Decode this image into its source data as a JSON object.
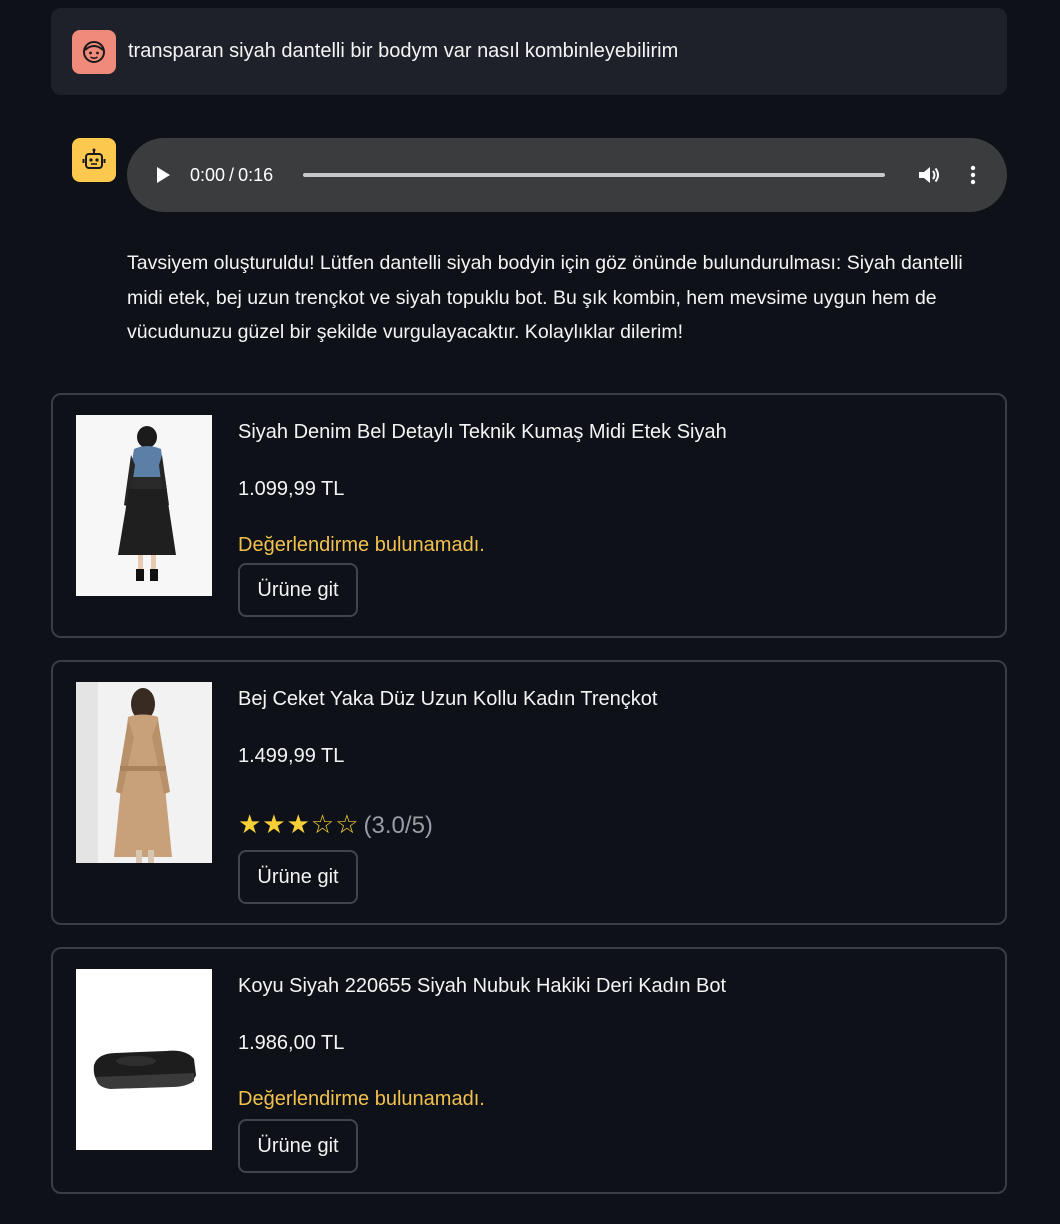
{
  "user_message": {
    "text": "transparan siyah dantelli bir bodym var nasıl kombinleyebilirim",
    "avatar_icon": "user-face-icon",
    "avatar_color": "#f08a7b"
  },
  "bot_message": {
    "avatar_icon": "robot-icon",
    "avatar_color": "#fcc94e",
    "audio": {
      "current_time": "0:00",
      "duration": "0:16",
      "separator": "/",
      "progress": 0,
      "play_icon": "play-icon",
      "volume_icon": "volume-icon",
      "menu_icon": "more-vertical-icon"
    },
    "text": "Tavsiyem oluşturuldu! Lütfen dantelli siyah bodyin için göz önünde bulundurulması: Siyah dantelli midi etek, bej uzun trençkot ve siyah topuklu bot. Bu şık kombin, hem mevsime uygun hem de vücudunuzu güzel bir şekilde vurgulayacaktır. Kolaylıklar dilerim!"
  },
  "products": [
    {
      "title": "Siyah Denim Bel Detaylı Teknik Kumaş Midi Etek Siyah",
      "price": "1.099,99 TL",
      "rating_text": "Değerlendirme bulunamadı.",
      "button_label": "Ürüne git",
      "image": "skirt-product-image"
    },
    {
      "title": "Bej Ceket Yaka Düz Uzun Kollu Kadın Trençkot",
      "price": "1.499,99 TL",
      "stars": "★★★☆☆",
      "rating_value": 3.0,
      "rating_label": "(3.0/5)",
      "button_label": "Ürüne git",
      "image": "trenchcoat-product-image"
    },
    {
      "title": "Koyu Siyah 220655 Siyah Nubuk Hakiki Deri Kadın Bot",
      "price": "1.986,00 TL",
      "rating_text": "Değerlendirme bulunamadı.",
      "button_label": "Ürüne git",
      "image": "boot-product-image"
    }
  ],
  "colors": {
    "background": "#0e1117",
    "user_bubble": "#1e212a",
    "audio_bg": "#3b3c3e",
    "warning_text": "#f2c14e",
    "star": "#f7d038"
  }
}
